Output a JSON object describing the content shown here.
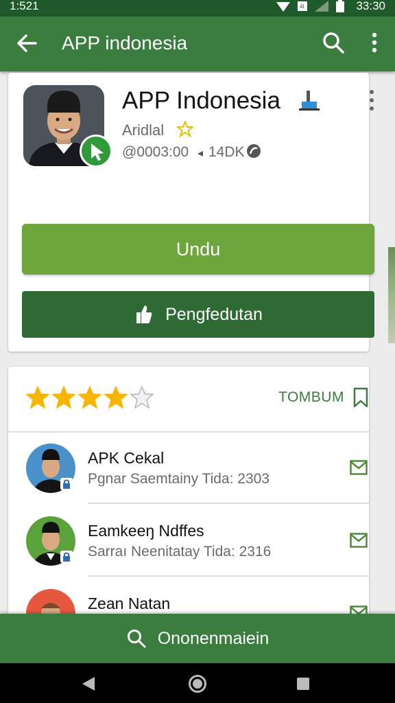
{
  "status_bar": {
    "time_left": "1:521",
    "time_right": "33:30",
    "sim_label": "4l"
  },
  "app_bar": {
    "title": "APP indonesia"
  },
  "app": {
    "name": "APP Indonesia",
    "developer": "Aridlal",
    "meta_text": "@0003:00",
    "meta_count": "14DK"
  },
  "buttons": {
    "primary": "Undu",
    "secondary": "Pengfedutan"
  },
  "rating": {
    "value": 4,
    "max": 5,
    "action_label": "TOMBUM"
  },
  "reviews": [
    {
      "name": "APK Cekal",
      "subtitle": "Pgnar Saemtainy Tida: 2303",
      "avatar_color": "#4a90c9"
    },
    {
      "name": "Eamkeeŋ Ndffes",
      "subtitle": "Sarraı Neenitatay Tida: 2316",
      "avatar_color": "#5aa33a"
    },
    {
      "name": "Zean Natan",
      "subtitle": "",
      "avatar_color": "#e6583e"
    }
  ],
  "bottom_search": {
    "label": "Ononenmaiein"
  },
  "colors": {
    "status_bar": "#1f5a2a",
    "app_bar": "#3b7d3e",
    "primary_button": "#6ea63c",
    "secondary_button": "#2f6a35",
    "star": "#f7b500"
  }
}
